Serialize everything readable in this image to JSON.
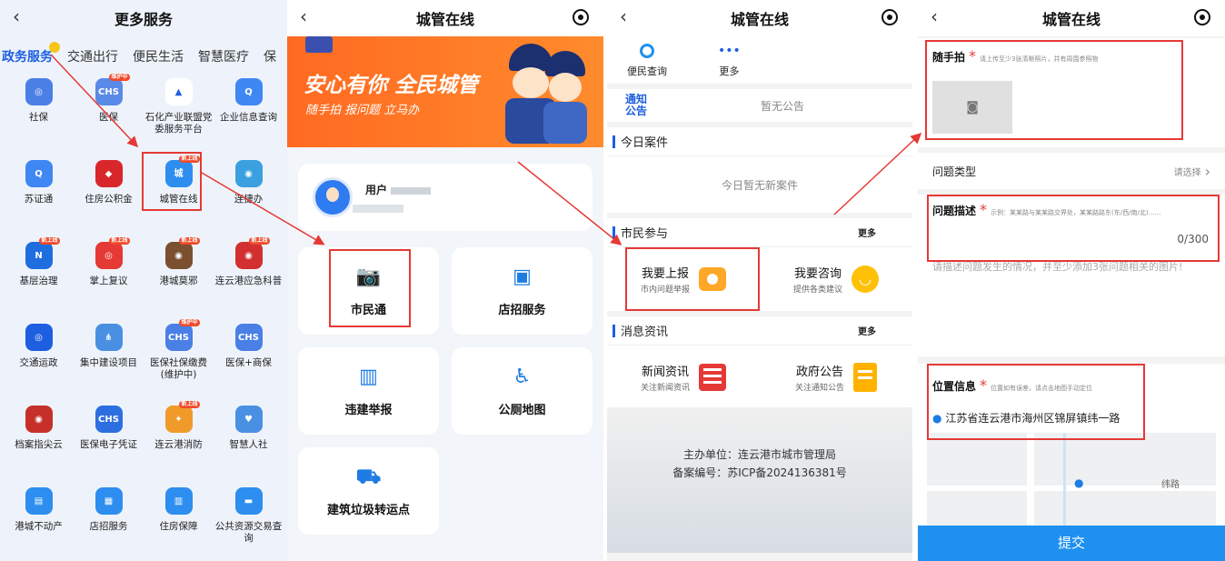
{
  "panel1": {
    "title": "更多服务",
    "tabs": [
      "政务服务",
      "交通出行",
      "便民生活",
      "智慧医疗",
      "保"
    ],
    "badge_new": "新上线",
    "badge_maint": "维护中",
    "services": [
      {
        "label": "社保",
        "color": "#4a7fe6",
        "glyph": "◎"
      },
      {
        "label": "医保",
        "color": "#5a8ae8",
        "glyph": "CHS"
      },
      {
        "label": "石化产业联盟党委服务平台",
        "color": "#ffffff",
        "glyph": "▲"
      },
      {
        "label": "企业信息查询",
        "color": "#3f87f2",
        "glyph": "Q"
      },
      {
        "label": "苏证通",
        "color": "#3f87f2",
        "glyph": "Q"
      },
      {
        "label": "住房公积金",
        "color": "#d9262a",
        "glyph": "◆"
      },
      {
        "label": "城管在线",
        "color": "#2d8ef0",
        "glyph": "城"
      },
      {
        "label": "连捷办",
        "color": "#3aa0e0",
        "glyph": "◉"
      },
      {
        "label": "基层治理",
        "color": "#1e6ee0",
        "glyph": "N"
      },
      {
        "label": "掌上复议",
        "color": "#e53935",
        "glyph": "◎"
      },
      {
        "label": "港城莫邪",
        "color": "#7a5030",
        "glyph": "◉"
      },
      {
        "label": "连云港应急科普",
        "color": "#d23030",
        "glyph": "◉"
      },
      {
        "label": "交通运政",
        "color": "#1d5fe0",
        "glyph": "◎"
      },
      {
        "label": "集中建设项目",
        "color": "#4a90e2",
        "glyph": "⋔"
      },
      {
        "label": "医保社保缴费(维护中)",
        "color": "#4a7fe6",
        "glyph": "CHS"
      },
      {
        "label": "医保+商保",
        "color": "#4a7fe6",
        "glyph": "CHS"
      },
      {
        "label": "档案指尖云",
        "color": "#c7302a",
        "glyph": "◉"
      },
      {
        "label": "医保电子凭证",
        "color": "#2d6fe0",
        "glyph": "CHS"
      },
      {
        "label": "连云港消防",
        "color": "#f09a2a",
        "glyph": "✦"
      },
      {
        "label": "智慧人社",
        "color": "#4a90e2",
        "glyph": "♥"
      },
      {
        "label": "港城不动产",
        "color": "#2d8ef0",
        "glyph": "▤"
      },
      {
        "label": "店招服务",
        "color": "#2d8ef0",
        "glyph": "▦"
      },
      {
        "label": "住房保障",
        "color": "#2d8ef0",
        "glyph": "▥"
      },
      {
        "label": "公共资源交易查询",
        "color": "#2d8ef0",
        "glyph": "▬"
      }
    ]
  },
  "panel2": {
    "title": "城管在线",
    "banner_line1": "安心有你 全民城管",
    "banner_line2": "随手拍 报问题 立马办",
    "user_name": "用户",
    "cards": [
      {
        "label": "市民通",
        "glyph": "📷"
      },
      {
        "label": "店招服务",
        "glyph": "▣"
      },
      {
        "label": "违建举报",
        "glyph": "▥"
      },
      {
        "label": "公厕地图",
        "glyph": "♿"
      },
      {
        "label": "建筑垃圾转运点",
        "glyph": "⛟"
      }
    ]
  },
  "panel3": {
    "title": "城管在线",
    "top_items": [
      "便民查询",
      "更多"
    ],
    "notice_label": "通知公告",
    "notice_text": "暂无公告",
    "today_title": "今日案件",
    "today_empty": "今日暂无新案件",
    "citizen_title": "市民参与",
    "more": "更多",
    "report_title": "我要上报",
    "report_sub": "市内问题举报",
    "consult_title": "我要咨询",
    "consult_sub": "提供各类建议",
    "news_title": "消息资讯",
    "news_item_title": "新闻资讯",
    "news_item_sub": "关注新闻资讯",
    "gov_title": "政府公告",
    "gov_sub": "关注通知公告",
    "host": "主办单位：连云港市城市管理局",
    "icp": "备案编号：苏ICP备2024136381号"
  },
  "panel4": {
    "title": "城管在线",
    "photo_label": "随手拍",
    "photo_hint": "请上传至少3张清晰照片，并有周围参照物",
    "type_label": "问题类型",
    "type_select": "请选择",
    "desc_label": "问题描述",
    "desc_hint": "示例：某某路与某某路交界处，某某路路东(东/西/南/北)……",
    "desc_count": "0/300",
    "desc_placeholder": "请描述问题发生的情况，并至少添加3张问题相关的图片!",
    "loc_label": "位置信息",
    "loc_hint": "位置如有误差，请点击地图手动定位",
    "loc_value": "江苏省连云港市海州区锦屏镇纬一路",
    "map_road": "纬路",
    "submit": "提交"
  }
}
